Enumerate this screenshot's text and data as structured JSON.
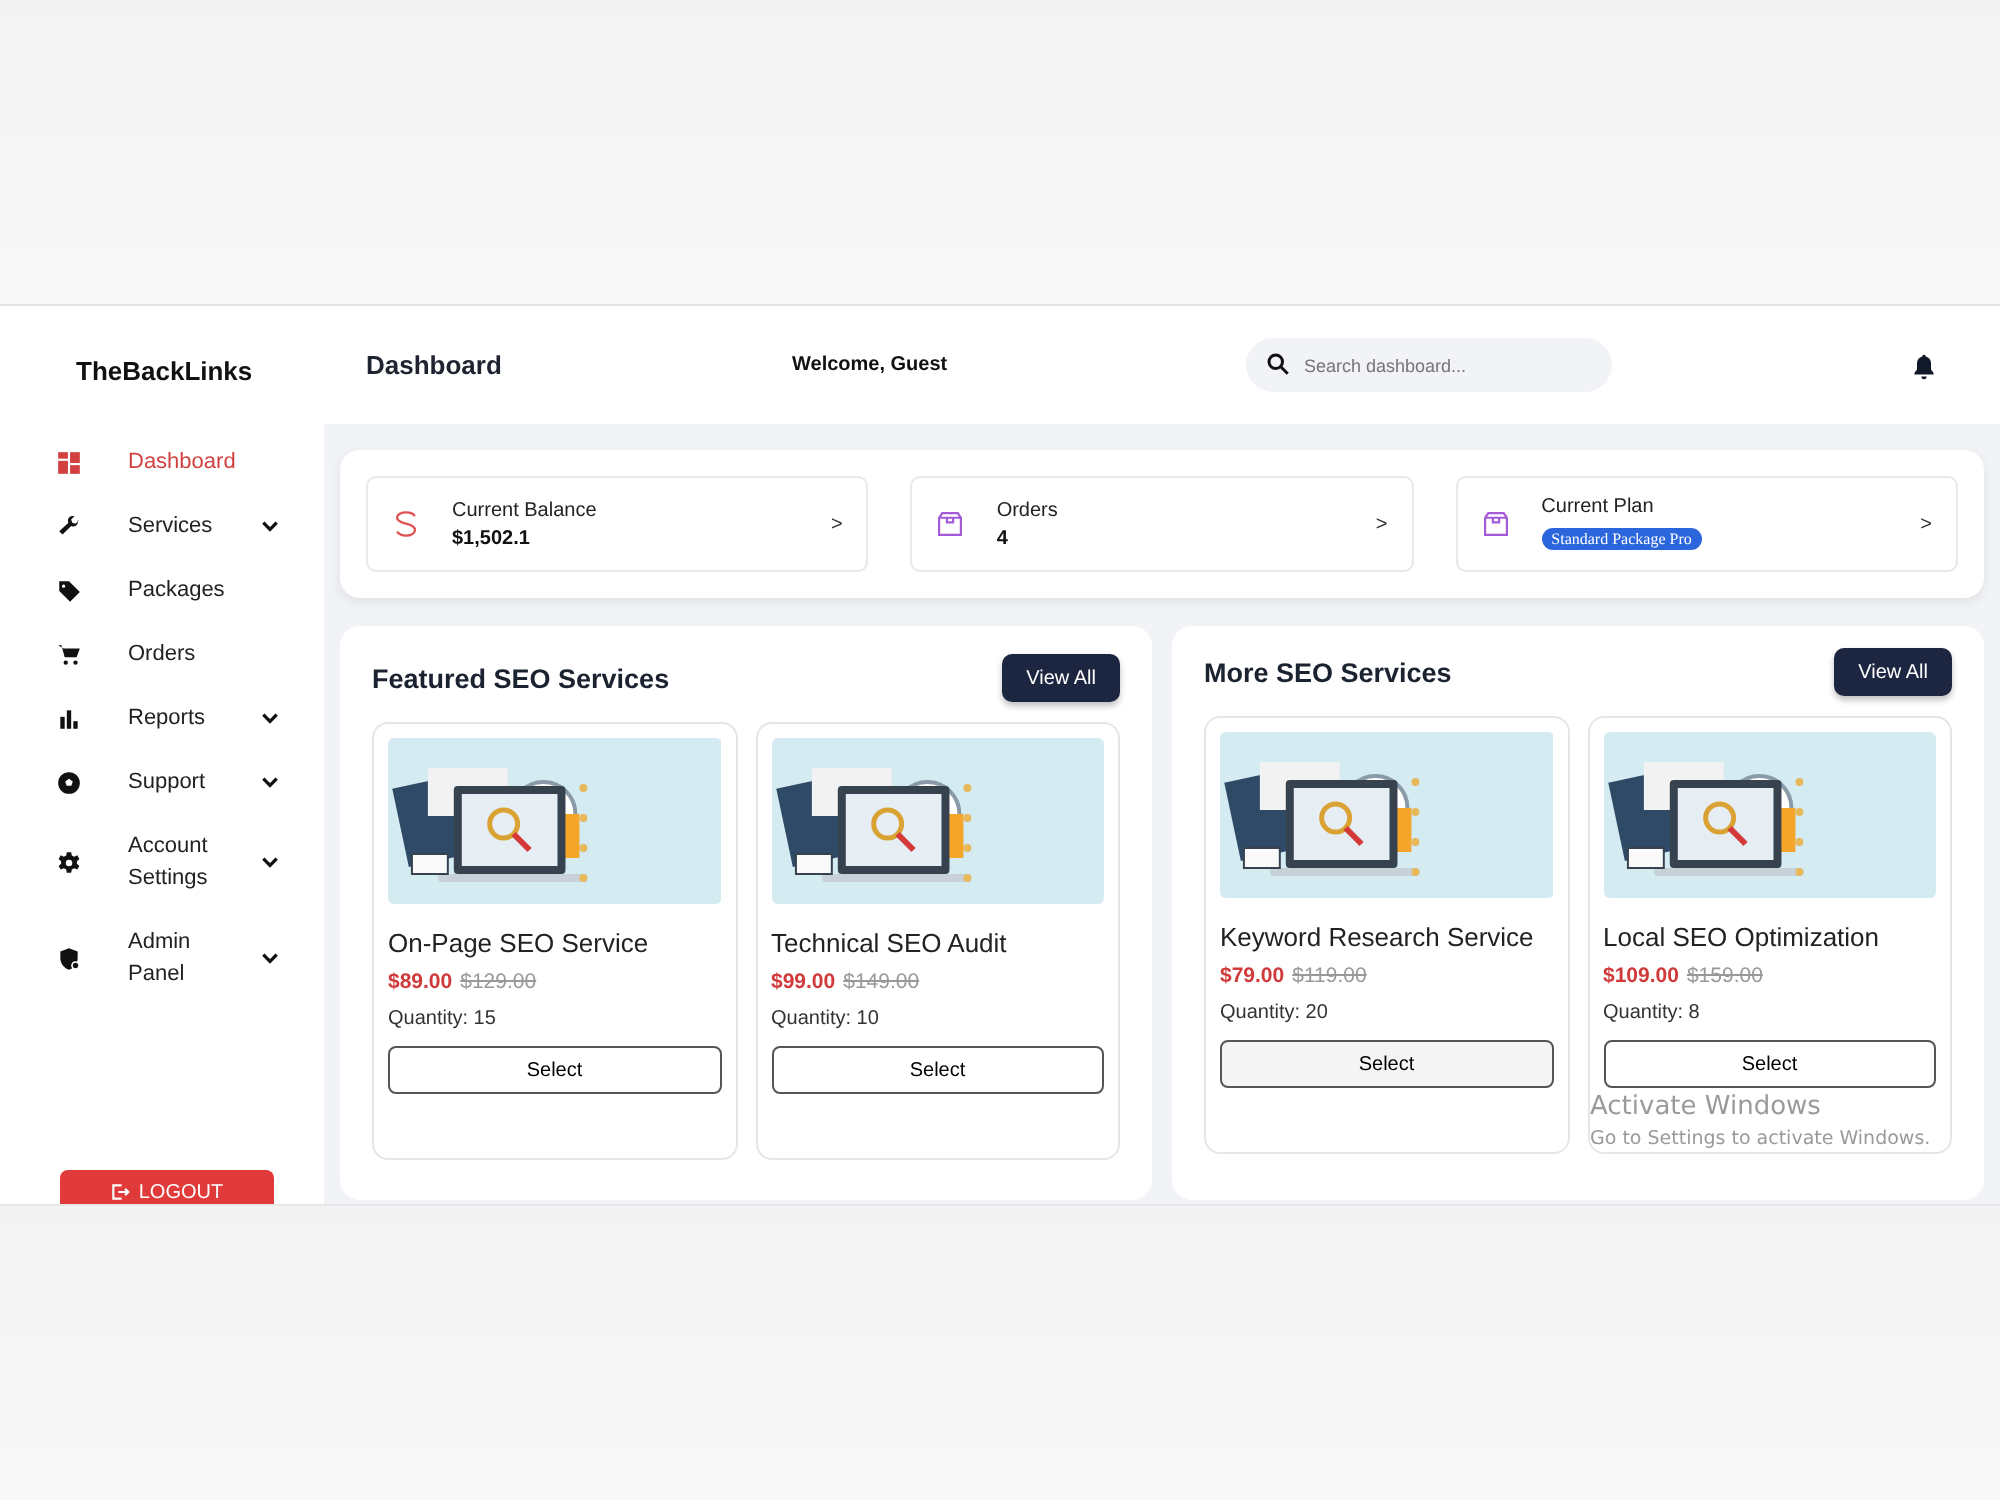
{
  "brand": "TheBackLinks",
  "header": {
    "title": "Dashboard",
    "welcome": "Welcome, Guest",
    "search": {
      "placeholder": "Search dashboard..."
    }
  },
  "sidebar": {
    "items": [
      {
        "label": "Dashboard",
        "selected": true,
        "submenu": false
      },
      {
        "label": "Services",
        "selected": false,
        "submenu": true
      },
      {
        "label": "Packages",
        "selected": false,
        "submenu": false
      },
      {
        "label": "Orders",
        "selected": false,
        "submenu": false
      },
      {
        "label": "Reports",
        "selected": false,
        "submenu": true
      },
      {
        "label": "Support",
        "selected": false,
        "submenu": true
      },
      {
        "label": "Account Settings",
        "selected": false,
        "submenu": true
      },
      {
        "label": "Admin Panel",
        "selected": false,
        "submenu": true
      }
    ],
    "logout": "LOGOUT"
  },
  "stats": [
    {
      "label": "Current Balance",
      "value": "$1,502.1",
      "kind": "money",
      "arrow": ">"
    },
    {
      "label": "Orders",
      "value": "4",
      "kind": "box",
      "arrow": ">"
    },
    {
      "label": "Current Plan",
      "badge": "Standard Package Pro",
      "kind": "box",
      "arrow": ">"
    }
  ],
  "sections": [
    {
      "title": "Featured SEO Services",
      "button": "View All",
      "products": [
        {
          "name": "On-Page SEO Service",
          "price": "$89.00",
          "old_price": "$129.00",
          "quantity": "Quantity: 15",
          "button": "Select"
        },
        {
          "name": "Technical SEO Audit",
          "price": "$99.00",
          "old_price": "$149.00",
          "quantity": "Quantity: 10",
          "button": "Select"
        }
      ]
    },
    {
      "title": "More SEO Services",
      "button": "View All",
      "products": [
        {
          "name": "Keyword Research Service",
          "price": "$79.00",
          "old_price": "$119.00",
          "quantity": "Quantity: 20",
          "button": "Select"
        },
        {
          "name": "Local SEO Optimization",
          "price": "$109.00",
          "old_price": "$159.00",
          "quantity": "Quantity: 8",
          "button": "Select"
        }
      ]
    }
  ],
  "os_overlay": {
    "title": "Activate Windows",
    "text": "Go to Settings to activate Windows."
  }
}
